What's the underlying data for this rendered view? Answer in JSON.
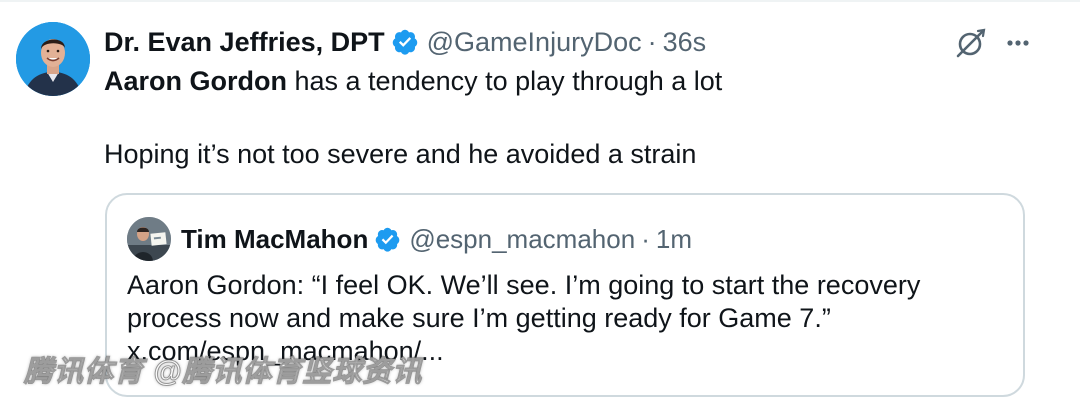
{
  "tweet": {
    "author_name": "Dr. Evan Jeffries, DPT",
    "handle": "@GameInjuryDoc",
    "separator": "·",
    "time": "36s",
    "text_line1_mention": "Aaron Gordon",
    "text_line1_rest": " has a tendency to play through a lot",
    "text_line2": "Hoping it’s not too severe and he avoided a strain",
    "icons": {
      "grok": "grok-icon",
      "more": "more-icon",
      "verified": "verified-badge-icon"
    }
  },
  "quote": {
    "author_name": "Tim MacMahon",
    "handle": "@espn_macmahon",
    "separator": "·",
    "time": "1m",
    "text_line1": "Aaron Gordon: “I feel OK. We’ll see. I’m going to start the recovery",
    "text_line2": "process now and make sure I’m getting ready for Game 7.”",
    "link": "x.com/espn_macmahon/..."
  },
  "watermark": "腾讯体育 @腾讯体育竖球资讯",
  "colors": {
    "text": "#0f1419",
    "secondary": "#536471",
    "verified": "#1d9bf0",
    "border": "#cfd9de"
  }
}
